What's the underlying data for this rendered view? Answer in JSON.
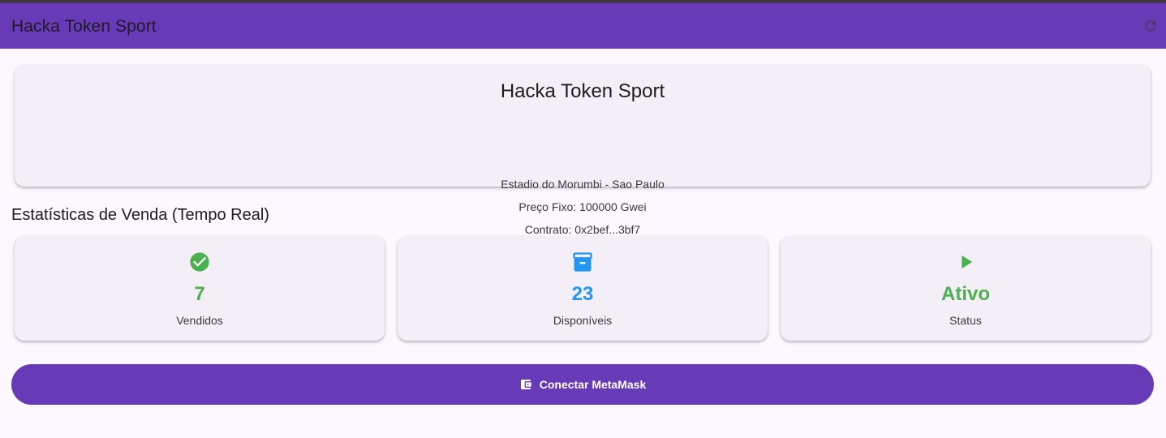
{
  "appbar": {
    "title": "Hacka Token Sport",
    "refresh_icon": "refresh-icon"
  },
  "event": {
    "title": "Hacka Token Sport",
    "location": "Estadio do Morumbi - Sao Paulo",
    "price": "Preço Fixo: 100000 Gwei",
    "contract": "Contrato: 0x2bef...3bf7"
  },
  "stats_section": {
    "title": "Estatísticas de Venda (Tempo Real)",
    "cards": [
      {
        "icon": "check-circle-icon",
        "value": "7",
        "label": "Vendidos",
        "color": "#4caf50"
      },
      {
        "icon": "inventory-box-icon",
        "value": "23",
        "label": "Disponíveis",
        "color": "#2196f3"
      },
      {
        "icon": "play-icon",
        "value": "Ativo",
        "label": "Status",
        "color": "#4caf50"
      }
    ]
  },
  "connect_button": {
    "label": "Conectar MetaMask",
    "icon": "wallet-icon"
  },
  "colors": {
    "primary": "#673ab7",
    "background": "#fdf7ff",
    "card": "#f4eff6",
    "green": "#4caf50",
    "blue": "#2196f3"
  }
}
